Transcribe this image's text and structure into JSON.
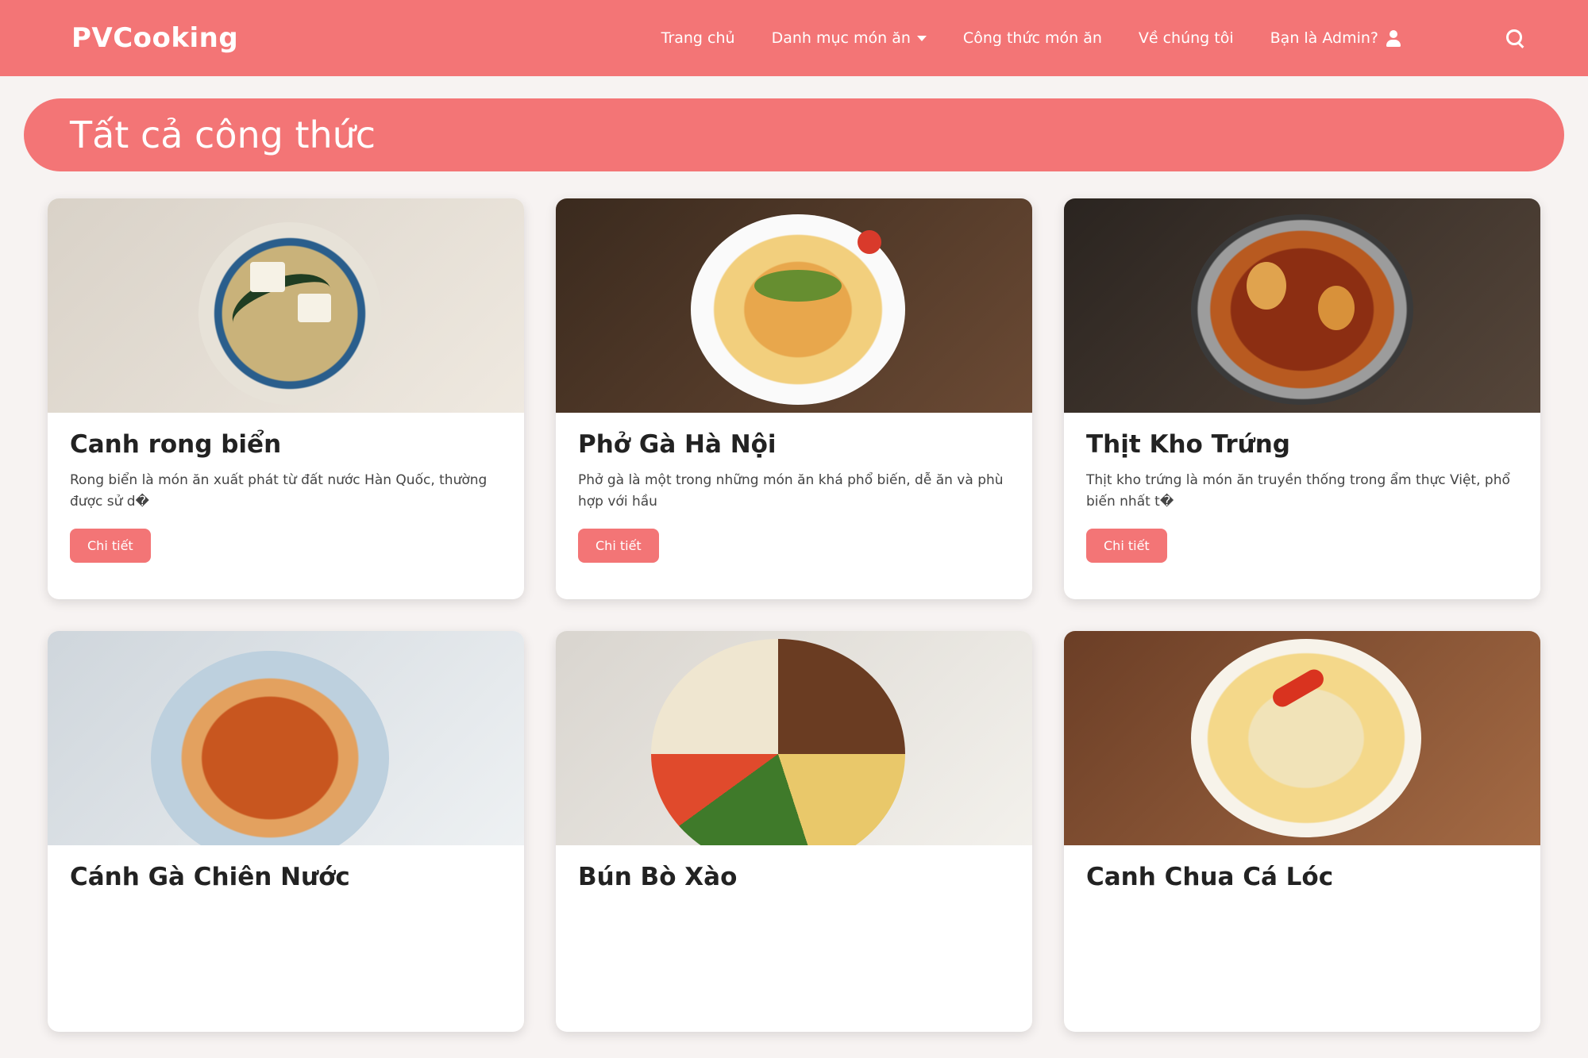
{
  "brand": "PVCooking",
  "nav": {
    "home": "Trang chủ",
    "categories": "Danh mục món ăn",
    "recipes": "Công thức món ăn",
    "about": "Về chúng tôi",
    "admin": "Bạn là Admin?"
  },
  "page_title": "Tất cả công thức",
  "detail_label": "Chi tiết",
  "recipes": [
    {
      "title": "Canh rong biển",
      "desc": "Rong biển là món ăn xuất phát từ đất nước Hàn Quốc, thường được sử d�"
    },
    {
      "title": "Phở Gà Hà Nội",
      "desc": "Phở gà là một trong những món ăn khá phổ biến, dễ ăn và phù hợp với hầu"
    },
    {
      "title": "Thịt Kho Trứng",
      "desc": "Thịt kho trứng là món ăn truyền thống trong ẩm thực Việt, phổ biến nhất t�"
    },
    {
      "title": "Cánh Gà Chiên Nước",
      "desc": ""
    },
    {
      "title": "Bún Bò Xào",
      "desc": ""
    },
    {
      "title": "Canh Chua Cá Lóc",
      "desc": ""
    }
  ],
  "colors": {
    "accent": "#f37576",
    "background": "#f7f3f2"
  },
  "icons": {
    "dropdown": "chevron-down-icon",
    "user": "user-icon",
    "search": "search-icon"
  }
}
